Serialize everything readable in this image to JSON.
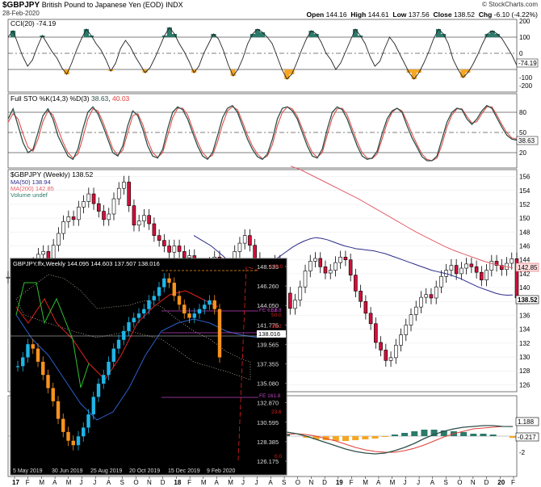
{
  "header": {
    "symbol": "$GBPJPY",
    "name": "British Pound to Japanese Yen (EOD)",
    "exchange": "INDX",
    "date": "28-Feb-2020",
    "stockcharts": "© StockCharts.com",
    "open_label": "Open",
    "open": "144.16",
    "high_label": "High",
    "high": "144.61",
    "low_label": "Low",
    "low": "137.56",
    "close_label": "Close",
    "close": "138.52",
    "chg_label": "Chg",
    "chg": "-6.10 (-4.22%)"
  },
  "cci": {
    "label": "CCI(20)",
    "value": "-74.19",
    "ticks": [
      "200",
      "100",
      "0",
      "-100",
      "-200"
    ],
    "last_tag": "-74.19",
    "up_color": "#2b7a6a",
    "down_color": "#f5a623"
  },
  "sto": {
    "label": "Full STO %K(14,3) %D(3)",
    "k_value": "38.63",
    "d_value": "40.03",
    "ticks": [
      "80",
      "50",
      "20"
    ],
    "last_tag": "38.63",
    "k_color": "#2d4f4a",
    "d_color": "#e0403a"
  },
  "price": {
    "label": "$GBPJPY (Weekly) 138.52",
    "ma50_label": "MA(50) 138.94",
    "ma200_label": "MA(200) 142.85",
    "volume_label": "Volume undef",
    "ma50_color": "#2a2a8a",
    "ma200_color": "#e0606a",
    "ticks": [
      "156",
      "154",
      "152",
      "150",
      "148",
      "146",
      "144",
      "142",
      "140",
      "138",
      "136",
      "134",
      "132",
      "130",
      "128",
      "126"
    ],
    "tag_ma200": "142.85",
    "tag_close": "138.52",
    "tag_ma50": "138.94"
  },
  "macd": {
    "ticks": [
      "2",
      "0",
      "-2"
    ],
    "tag1": "1.188",
    "tag2": "-0.217"
  },
  "x_axis": {
    "labels": [
      "17",
      "F",
      "M",
      "A",
      "M",
      "J",
      "J",
      "A",
      "S",
      "O",
      "N",
      "D",
      "18",
      "F",
      "M",
      "A",
      "M",
      "J",
      "J",
      "A",
      "S",
      "O",
      "N",
      "D",
      "19",
      "F",
      "M",
      "A",
      "M",
      "J",
      "J",
      "A",
      "S",
      "O",
      "N",
      "D",
      "20",
      "F"
    ]
  },
  "inset": {
    "title": "GBPJPY.ffx,Weekly",
    "ohlc": "144.095 144.603 137.507 138.016",
    "right_axis": [
      "148.535",
      "146.260",
      "144.050",
      "141.775",
      "139.565",
      "137.355",
      "135.080",
      "132.870",
      "130.595",
      "128.385",
      "126.175"
    ],
    "tag_now": "138.016",
    "fib_labels": [
      "100.0",
      "61.8",
      "50.0",
      "38.2",
      "FE 61.8",
      "FE 100.0",
      "FE 161.8",
      "23.6",
      "0.0"
    ],
    "dates": [
      "5 May 2019",
      "30 Jun 2019",
      "25 Aug 2019",
      "20 Oct 2019",
      "15 Dec 2019",
      "9 Feb 2020"
    ],
    "bull_color": "#1fb5e8",
    "bear_color": "#f7931e"
  },
  "chart_data": [
    {
      "type": "line",
      "title": "CCI(20)",
      "ylim": [
        -250,
        250
      ],
      "series": [
        {
          "name": "CCI(20)",
          "values": [
            100,
            140,
            60,
            -20,
            -80,
            -40,
            40,
            110,
            60,
            10,
            -30,
            -90,
            -130,
            -60,
            20,
            90,
            150,
            110,
            60,
            20,
            -40,
            -110,
            -60,
            30,
            80,
            40,
            -20,
            -70,
            -120,
            -90,
            -30,
            40,
            110,
            160,
            120,
            60,
            10,
            -50,
            -120,
            -80,
            0,
            60,
            120,
            90,
            20,
            -70,
            -140,
            -100,
            -30,
            60,
            120,
            150,
            130,
            100,
            60,
            -20,
            -100,
            -160,
            -130,
            -60,
            20,
            90,
            140,
            120,
            70,
            0,
            -40,
            -100,
            -60,
            10,
            80,
            150,
            110,
            60,
            -20,
            -80,
            -50,
            30,
            100,
            60,
            0,
            -60,
            -120,
            -160,
            -120,
            -60,
            10,
            90,
            150,
            120,
            60,
            -40,
            -100,
            -150,
            -120,
            -70,
            -10,
            60,
            120,
            140,
            120,
            90,
            40,
            -10,
            -74
          ]
        }
      ]
    },
    {
      "type": "line",
      "title": "Full STO %K(14,3) %D(3)",
      "ylim": [
        0,
        100
      ],
      "series": [
        {
          "name": "%K(14,3)",
          "values": [
            70,
            85,
            60,
            35,
            20,
            25,
            50,
            75,
            85,
            70,
            45,
            30,
            15,
            10,
            25,
            55,
            80,
            88,
            78,
            60,
            40,
            20,
            15,
            30,
            60,
            82,
            75,
            55,
            30,
            15,
            12,
            25,
            55,
            80,
            88,
            84,
            70,
            50,
            30,
            15,
            10,
            20,
            45,
            72,
            86,
            90,
            80,
            60,
            40,
            25,
            14,
            10,
            18,
            40,
            70,
            86,
            88,
            82,
            70,
            50,
            30,
            15,
            12,
            25,
            55,
            80,
            88,
            84,
            70,
            50,
            30,
            15,
            10,
            12,
            22,
            48,
            70,
            82,
            86,
            80,
            60,
            42,
            28,
            14,
            8,
            8,
            15,
            40,
            65,
            80,
            86,
            84,
            70,
            62,
            70,
            82,
            90,
            86,
            72,
            58,
            46,
            40,
            38.63
          ]
        },
        {
          "name": "%D(3)",
          "values": [
            65,
            78,
            70,
            48,
            28,
            22,
            40,
            66,
            82,
            76,
            55,
            36,
            20,
            12,
            18,
            42,
            70,
            85,
            82,
            66,
            46,
            26,
            16,
            24,
            50,
            75,
            78,
            62,
            38,
            20,
            13,
            20,
            45,
            72,
            86,
            86,
            76,
            56,
            36,
            20,
            12,
            16,
            36,
            62,
            82,
            88,
            84,
            66,
            46,
            30,
            18,
            11,
            15,
            32,
            60,
            80,
            88,
            85,
            74,
            56,
            36,
            20,
            13,
            20,
            46,
            72,
            85,
            86,
            76,
            56,
            36,
            20,
            12,
            11,
            18,
            40,
            64,
            80,
            86,
            82,
            66,
            48,
            32,
            18,
            10,
            8,
            12,
            32,
            58,
            76,
            85,
            85,
            74,
            64,
            66,
            78,
            88,
            88,
            76,
            62,
            50,
            42,
            40.03
          ]
        }
      ]
    },
    {
      "type": "line",
      "title": "$GBPJPY (Weekly)",
      "ylim": [
        126,
        157
      ],
      "series": [
        {
          "name": "Close",
          "values": [
            141.5,
            142.8,
            140.2,
            139.6,
            141.0,
            143.5,
            144.8,
            145.2,
            144.0,
            146.1,
            147.8,
            149.5,
            150.2,
            149.8,
            151.6,
            152.4,
            153.5,
            152.1,
            151.0,
            149.8,
            150.6,
            152.8,
            154.3,
            155.2,
            151.8,
            149.0,
            149.6,
            150.4,
            149.2,
            147.5,
            146.8,
            146.0,
            145.1,
            146.0,
            145.2,
            144.3,
            144.6,
            143.0,
            141.8,
            142.6,
            143.5,
            144.4,
            143.1,
            141.6,
            142.8,
            145.2,
            146.4,
            147.5,
            146.1,
            144.2,
            142.0,
            141.0,
            142.5,
            143.8,
            141.8,
            139.2,
            137.0,
            138.2,
            140.1,
            142.4,
            143.8,
            144.2,
            143.0,
            142.1,
            142.5,
            143.6,
            144.4,
            144.0,
            141.8,
            139.5,
            138.0,
            136.3,
            134.8,
            132.1,
            131.0,
            129.5,
            129.9,
            131.7,
            133.2,
            134.6,
            136.1,
            137.2,
            138.6,
            139.0,
            138.5,
            140.1,
            141.6,
            142.5,
            143.2,
            142.0,
            142.8,
            143.4,
            143.0,
            142.2,
            141.1,
            142.5,
            143.8,
            143.2,
            142.6,
            143.5,
            144.16,
            138.52
          ]
        },
        {
          "name": "MA(50)",
          "values": [
            147.5,
            147.0,
            146.5,
            146.0,
            145.3,
            144.6,
            143.8,
            143.2,
            142.7,
            142.4,
            142.3,
            142.5,
            142.9,
            143.4,
            144.0,
            144.6,
            145.2,
            145.8,
            146.3,
            146.7,
            147.0,
            147.2,
            147.1,
            146.9,
            146.6,
            146.3,
            146.0,
            145.8,
            145.6,
            145.5,
            145.4,
            145.3,
            145.1,
            144.9,
            144.6,
            144.3,
            144.0,
            143.7,
            143.4,
            143.1,
            142.8,
            142.5,
            142.3,
            142.1,
            141.9,
            141.6,
            141.3,
            140.9,
            140.5,
            140.1,
            139.8,
            139.5,
            139.2,
            139.0,
            138.9,
            138.94
          ]
        },
        {
          "name": "MA(200)",
          "values": [
            157.5,
            157.0,
            156.3,
            155.6,
            154.9,
            154.2,
            153.5,
            152.8,
            152.0,
            151.2,
            150.4,
            149.6,
            148.8,
            148.0,
            147.3,
            146.6,
            145.9,
            145.3,
            144.8,
            144.3,
            143.8,
            143.4,
            143.1,
            142.85
          ]
        }
      ]
    },
    {
      "type": "line",
      "title": "MACD",
      "ylim": [
        -3,
        3
      ],
      "series": [
        {
          "name": "MACD",
          "values": [
            0.5,
            0.3,
            0.0,
            -0.4,
            -0.8,
            -1.2,
            -1.6,
            -1.9,
            -2.1,
            -2.2,
            -2.1,
            -1.8,
            -1.4,
            -0.9,
            -0.3,
            0.2,
            0.6,
            0.9,
            1.1,
            1.2,
            1.3,
            1.3,
            1.2,
            1.188
          ]
        },
        {
          "name": "Signal",
          "values": [
            0.2,
            0.3,
            0.2,
            0.0,
            -0.3,
            -0.6,
            -1.0,
            -1.4,
            -1.7,
            -1.9,
            -2.0,
            -2.0,
            -1.8,
            -1.5,
            -1.1,
            -0.6,
            -0.1,
            0.3,
            0.6,
            0.9,
            1.0,
            1.1,
            1.2,
            1.2
          ]
        },
        {
          "name": "Histogram",
          "values": [
            0.3,
            0.0,
            -0.2,
            -0.4,
            -0.5,
            -0.6,
            -0.6,
            -0.5,
            -0.4,
            -0.3,
            -0.1,
            0.2,
            0.4,
            0.6,
            0.8,
            0.8,
            0.7,
            0.6,
            0.5,
            0.3,
            0.3,
            0.2,
            0.0,
            -0.217
          ]
        }
      ]
    }
  ]
}
